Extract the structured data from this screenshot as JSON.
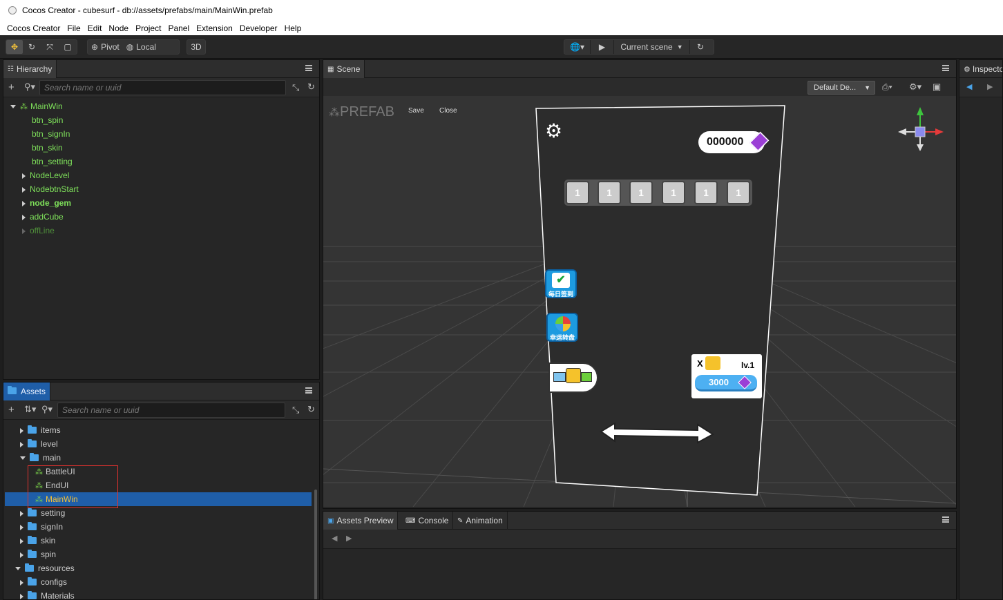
{
  "window": {
    "title": "Cocos Creator - cubesurf - db://assets/prefabs/main/MainWin.prefab"
  },
  "menu": [
    "Cocos Creator",
    "File",
    "Edit",
    "Node",
    "Project",
    "Panel",
    "Extension",
    "Developer",
    "Help"
  ],
  "toolbar": {
    "pivot": "Pivot",
    "local": "Local",
    "mode3d": "3D",
    "scene_select": "Current scene"
  },
  "hierarchy": {
    "tab": "Hierarchy",
    "search_placeholder": "Search name or uuid",
    "root": "MainWin",
    "items": [
      "btn_spin",
      "btn_signIn",
      "btn_skin",
      "btn_setting",
      "NodeLevel",
      "NodebtnStart",
      "node_gem",
      "addCube",
      "offLine"
    ]
  },
  "assets": {
    "tab": "Assets",
    "search_placeholder": "Search name or uuid",
    "items": [
      "items",
      "level",
      "main",
      "BattleUI",
      "EndUI",
      "MainWin",
      "setting",
      "signIn",
      "skin",
      "spin",
      "resources",
      "configs",
      "Materials"
    ]
  },
  "scene": {
    "tab": "Scene",
    "prefab_label": "PREFAB",
    "save": "Save",
    "close": "Close",
    "device": "Default De...",
    "game": {
      "gem_count": "000000",
      "slots": [
        "1",
        "1",
        "1",
        "1",
        "1",
        "1"
      ],
      "daily_label": "每日签到",
      "lucky_label": "幸运转盘",
      "card_x": "X",
      "card_level": "lv.1",
      "card_cost": "3000"
    }
  },
  "inspector": {
    "tab": "Inspecto"
  },
  "bottom": {
    "tabs": [
      "Assets Preview",
      "Console",
      "Animation"
    ]
  },
  "colors": {
    "accent": "#1f5ea8",
    "prefab_green": "#7ee05a",
    "selection": "#1f5ea8",
    "highlight_box": "#e0322f"
  }
}
